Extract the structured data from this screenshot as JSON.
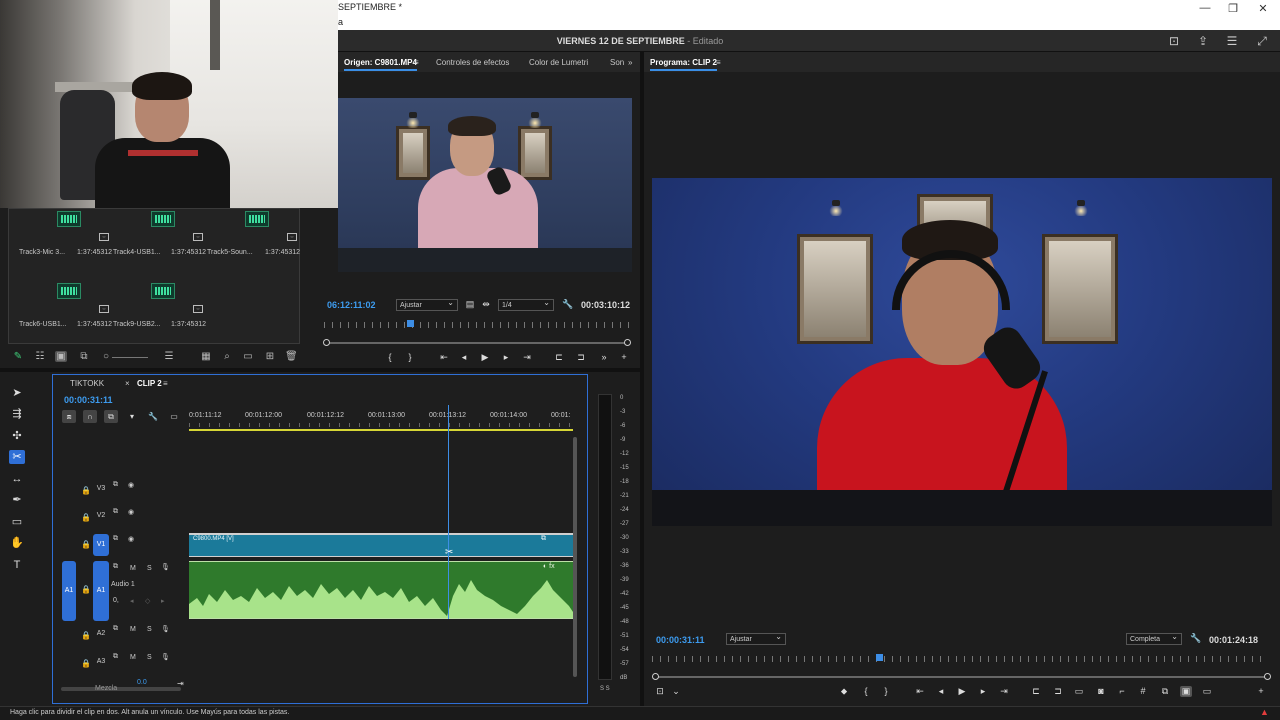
{
  "window": {
    "title": "SEPTIEMBRE *",
    "subtitle": "a",
    "controls": [
      "—",
      "❐",
      "✕"
    ]
  },
  "header": {
    "project_title": "VIERNES 12 DE SEPTIEMBRE",
    "edit_state": "- Editado"
  },
  "bin": {
    "items": [
      {
        "name": "Track3-Mic 3...",
        "duration": "1:37:45312"
      },
      {
        "name": "Track4-USB1...",
        "duration": "1:37:45312"
      },
      {
        "name": "Track5-Soun...",
        "duration": "1:37:45312"
      },
      {
        "name": "Track6-USB1...",
        "duration": "1:37:45312"
      },
      {
        "name": "Track9-USB2...",
        "duration": "1:37:45312"
      }
    ]
  },
  "source": {
    "tabs": [
      {
        "label": "Origen: C9801.MP4",
        "active": true
      },
      {
        "label": "Controles de efectos",
        "active": false
      },
      {
        "label": "Color de Lumetri",
        "active": false
      },
      {
        "label": "Son",
        "active": false
      }
    ],
    "timecode_in": "06:12:11:02",
    "fit": "Ajustar",
    "resolution": "1/4",
    "duration": "00:03:10:12"
  },
  "program": {
    "tab_label": "Programa: CLIP 2",
    "timecode": "00:00:31:11",
    "fit": "Ajustar",
    "resolution": "Completa",
    "duration": "00:01:24:18"
  },
  "timeline": {
    "tabs": [
      {
        "label": "TIKTOKK",
        "active": false
      },
      {
        "label": "CLIP 2",
        "active": true
      }
    ],
    "timecode": "00:00:31:11",
    "ruler_labels": [
      "0:01:11:12",
      "00:01:12:00",
      "00:01:12:12",
      "00:01:13:00",
      "00:01:13:12",
      "00:01:14:00",
      "00:01:"
    ],
    "tracks": {
      "video": [
        "V3",
        "V2",
        "V1"
      ],
      "audio": [
        "A1",
        "A2",
        "A3"
      ],
      "audio1_label": "Audio 1",
      "audio1_volume": "0,",
      "source_patch": "A1"
    },
    "clip_video_label": "C9800.MP4 [V]",
    "zoom_value": "0.0",
    "bottom_label": "Mezcla"
  },
  "meter": {
    "labels": [
      "0",
      "-3",
      "-6",
      "-9",
      "-12",
      "-15",
      "-18",
      "-21",
      "-24",
      "-27",
      "-30",
      "-33",
      "-36",
      "-39",
      "-42",
      "-45",
      "-48",
      "-51",
      "-54",
      "-57",
      "dB"
    ],
    "solo": "S S"
  },
  "status": {
    "text": "Haga clic para dividir el clip en dos. Alt anula un vínculo. Use Mayús para todas las pistas."
  }
}
